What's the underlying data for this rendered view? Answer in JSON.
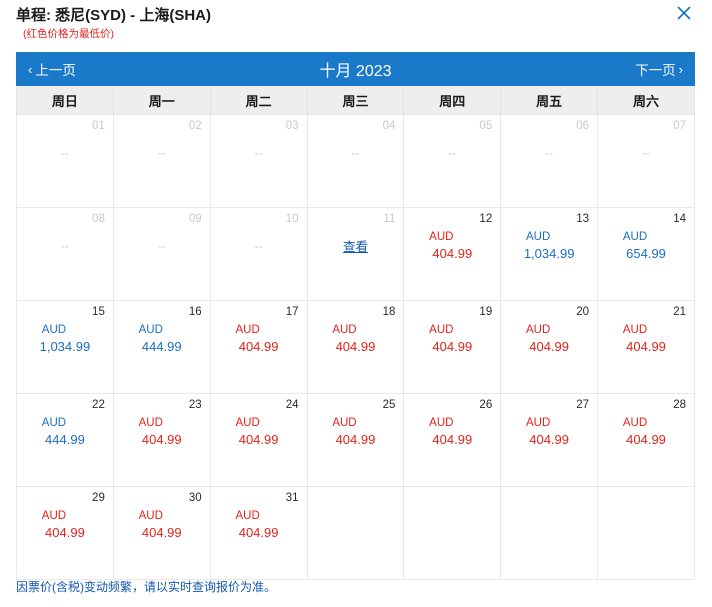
{
  "header": {
    "title": "单程: 悉尼(SYD) - 上海(SHA)",
    "subtitle": "(红色价格为最低价)",
    "close_icon": "close-icon"
  },
  "navbar": {
    "prev_label": "上一页",
    "prev_arrow": "‹",
    "next_label": "下一页",
    "next_arrow": "›",
    "month_title": "十月 2023",
    "bar_color": "#1a7ac9"
  },
  "calendar": {
    "weekday_headers": [
      "周日",
      "周一",
      "周二",
      "周三",
      "周四",
      "周五",
      "周六"
    ],
    "currency": "AUD",
    "empty_marker": "--",
    "view_label": "查看",
    "low_price_color": "#e2231a",
    "normal_price_color": "#1a6fc4",
    "weeks": [
      [
        {
          "day": "01",
          "state": "muted",
          "value": "--"
        },
        {
          "day": "02",
          "state": "muted",
          "value": "--"
        },
        {
          "day": "03",
          "state": "muted",
          "value": "--"
        },
        {
          "day": "04",
          "state": "muted",
          "value": "--"
        },
        {
          "day": "05",
          "state": "muted",
          "value": "--"
        },
        {
          "day": "06",
          "state": "muted",
          "value": "--"
        },
        {
          "day": "07",
          "state": "muted",
          "value": "--"
        }
      ],
      [
        {
          "day": "08",
          "state": "muted",
          "value": "--"
        },
        {
          "day": "09",
          "state": "muted",
          "value": "--"
        },
        {
          "day": "10",
          "state": "muted",
          "value": "--"
        },
        {
          "day": "11",
          "state": "muted",
          "value": "查看",
          "kind": "link"
        },
        {
          "day": "12",
          "state": "active",
          "currency": "AUD",
          "amount": "404.99",
          "kind": "low"
        },
        {
          "day": "13",
          "state": "active",
          "currency": "AUD",
          "amount": "1,034.99",
          "kind": "normal"
        },
        {
          "day": "14",
          "state": "active",
          "currency": "AUD",
          "amount": "654.99",
          "kind": "normal"
        }
      ],
      [
        {
          "day": "15",
          "state": "active",
          "currency": "AUD",
          "amount": "1,034.99",
          "kind": "normal"
        },
        {
          "day": "16",
          "state": "active",
          "currency": "AUD",
          "amount": "444.99",
          "kind": "normal"
        },
        {
          "day": "17",
          "state": "active",
          "currency": "AUD",
          "amount": "404.99",
          "kind": "low"
        },
        {
          "day": "18",
          "state": "active",
          "currency": "AUD",
          "amount": "404.99",
          "kind": "low"
        },
        {
          "day": "19",
          "state": "active",
          "currency": "AUD",
          "amount": "404.99",
          "kind": "low"
        },
        {
          "day": "20",
          "state": "active",
          "currency": "AUD",
          "amount": "404.99",
          "kind": "low"
        },
        {
          "day": "21",
          "state": "active",
          "currency": "AUD",
          "amount": "404.99",
          "kind": "low"
        }
      ],
      [
        {
          "day": "22",
          "state": "active",
          "currency": "AUD",
          "amount": "444.99",
          "kind": "normal"
        },
        {
          "day": "23",
          "state": "active",
          "currency": "AUD",
          "amount": "404.99",
          "kind": "low"
        },
        {
          "day": "24",
          "state": "active",
          "currency": "AUD",
          "amount": "404.99",
          "kind": "low"
        },
        {
          "day": "25",
          "state": "active",
          "currency": "AUD",
          "amount": "404.99",
          "kind": "low"
        },
        {
          "day": "26",
          "state": "active",
          "currency": "AUD",
          "amount": "404.99",
          "kind": "low"
        },
        {
          "day": "27",
          "state": "active",
          "currency": "AUD",
          "amount": "404.99",
          "kind": "low"
        },
        {
          "day": "28",
          "state": "active",
          "currency": "AUD",
          "amount": "404.99",
          "kind": "low"
        }
      ],
      [
        {
          "day": "29",
          "state": "active",
          "currency": "AUD",
          "amount": "404.99",
          "kind": "low"
        },
        {
          "day": "30",
          "state": "active",
          "currency": "AUD",
          "amount": "404.99",
          "kind": "low"
        },
        {
          "day": "31",
          "state": "active",
          "currency": "AUD",
          "amount": "404.99",
          "kind": "low"
        },
        {
          "day": "",
          "state": "blank"
        },
        {
          "day": "",
          "state": "blank"
        },
        {
          "day": "",
          "state": "blank"
        },
        {
          "day": "",
          "state": "blank"
        }
      ]
    ]
  },
  "footer": {
    "note": "因票价(含税)变动频繁，请以实时查询报价为准。"
  }
}
